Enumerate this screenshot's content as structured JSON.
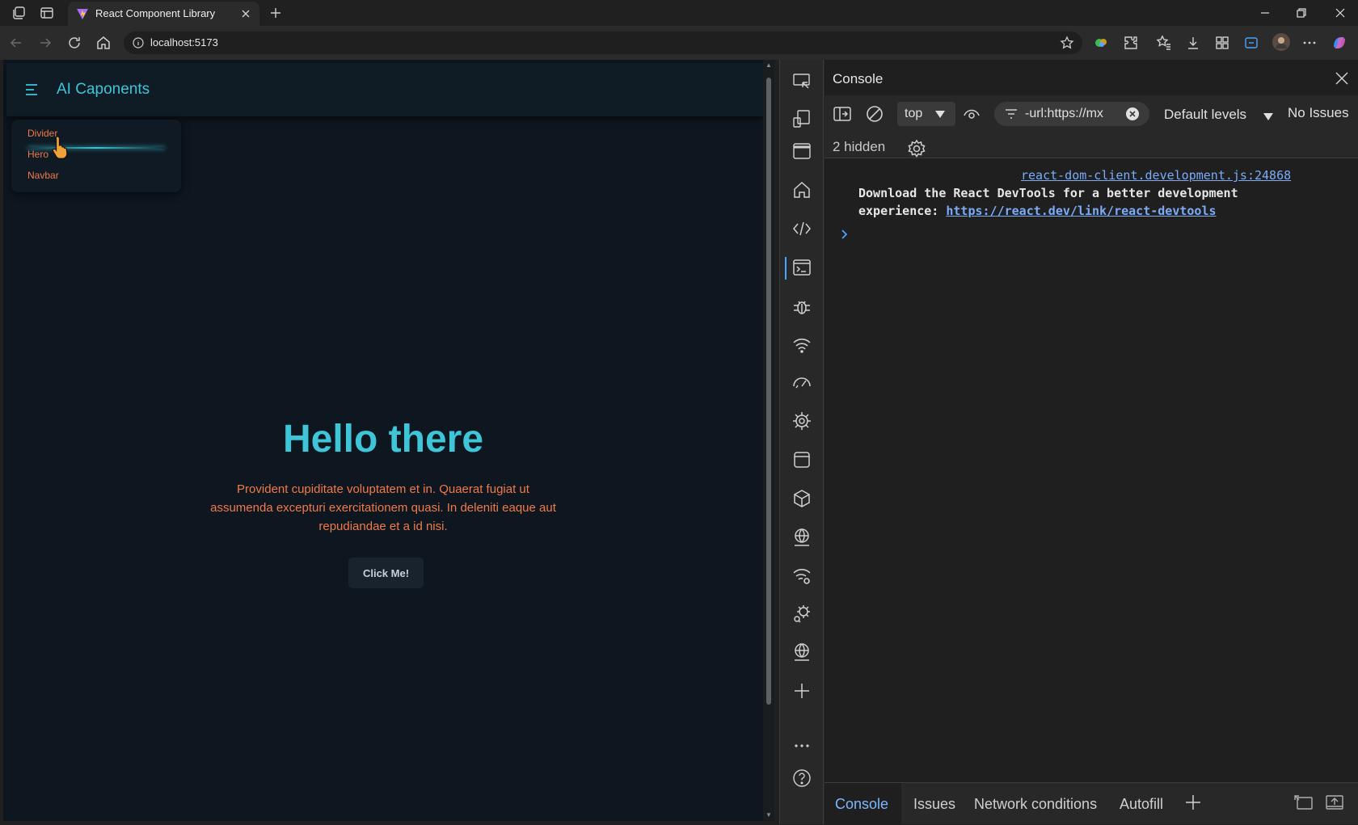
{
  "browser": {
    "tab_title": "React Component Library",
    "url": "localhost:5173"
  },
  "app": {
    "title": "AI Caponents",
    "menu": [
      "Divider",
      "Hero",
      "Navbar"
    ],
    "hero": {
      "title": "Hello there",
      "text": "Provident cupiditate voluptatem et in. Quaerat fugiat ut assumenda excepturi exercitationem quasi. In deleniti eaque aut repudiandae et a id nisi.",
      "button": "Click Me!"
    }
  },
  "devtools": {
    "panel_title": "Console",
    "context": "top",
    "filter": "-url:https://mx",
    "levels": "Default levels",
    "issues": "No Issues",
    "hidden": "2 hidden",
    "source_link": "react-dom-client.development.js:24868",
    "message_line1": "Download the React DevTools for a better development",
    "message_line2_prefix": "experience: ",
    "message_link": "https://react.dev/link/react-devtools",
    "drawer_tabs": [
      "Console",
      "Issues",
      "Network conditions",
      "Autofill"
    ]
  },
  "colors": {
    "accent_cyan": "#3ec6d8",
    "accent_orange": "#f07a4a",
    "link_blue": "#7cacf8",
    "page_bg": "#0e1620"
  }
}
